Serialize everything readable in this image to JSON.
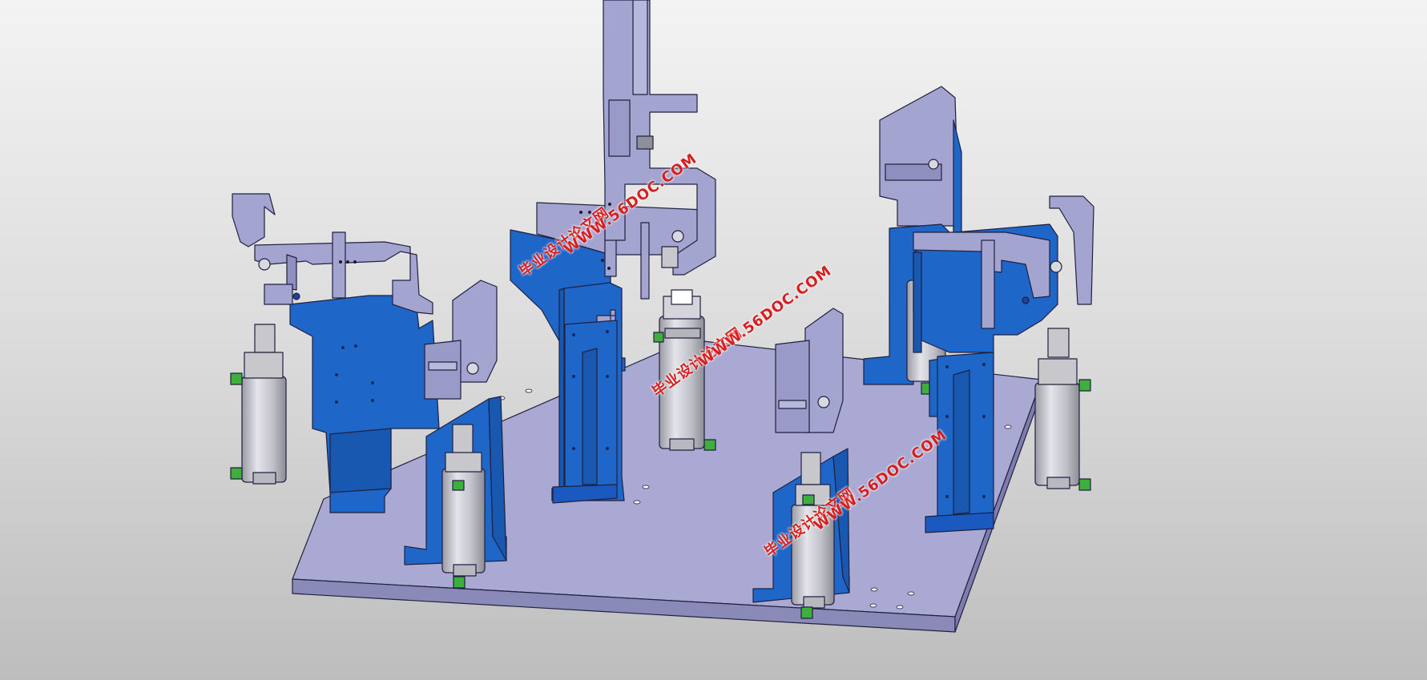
{
  "colors": {
    "background_top": "#f3f3f3",
    "background_bottom": "#bdbdbd",
    "base_plate": "#a9a9d3",
    "support_blue": "#1f66c9",
    "clamp_arm": "#a4a4d0",
    "cylinder": "#c4c4c8",
    "fitting_green": "#3caf3c",
    "edge_line": "#202040",
    "watermark": "#d42020"
  },
  "watermarks": [
    {
      "cn": "毕业设计论文网",
      "url": "WWW.56DOC.COM"
    },
    {
      "cn": "毕业设计论文网",
      "url": "WWW.56DOC.COM"
    },
    {
      "cn": "毕业设计论文网",
      "url": "WWW.56DOC.COM"
    }
  ]
}
